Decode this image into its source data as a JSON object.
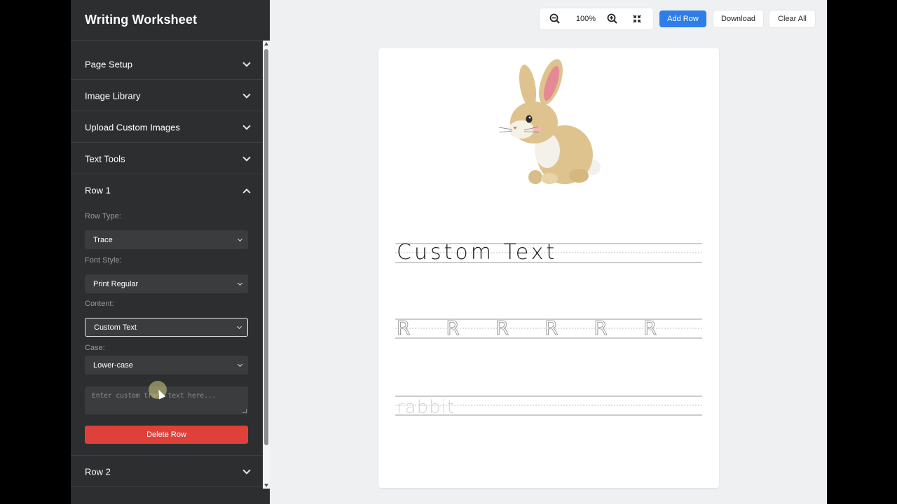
{
  "sidebar": {
    "title": "Writing Worksheet",
    "sections": [
      {
        "label": "Page Setup",
        "expanded": false
      },
      {
        "label": "Image Library",
        "expanded": false
      },
      {
        "label": "Upload Custom Images",
        "expanded": false
      },
      {
        "label": "Text Tools",
        "expanded": false
      },
      {
        "label": "Row 1",
        "expanded": true
      },
      {
        "label": "Row 2",
        "expanded": false
      }
    ],
    "row1": {
      "row_type_label": "Row Type:",
      "row_type_value": "Trace",
      "font_style_label": "Font Style:",
      "font_style_value": "Print Regular",
      "content_label": "Content:",
      "content_value": "Custom Text",
      "case_label": "Case:",
      "case_value": "Lower-case",
      "custom_text_placeholder": "Enter custom trace text here...",
      "delete_label": "Delete Row"
    }
  },
  "toolbar": {
    "zoom_out_icon": "zoom-out-icon",
    "zoom_level": "100%",
    "zoom_in_icon": "zoom-in-icon",
    "fit_icon": "fit-screen-icon",
    "add_row_label": "Add Row",
    "download_label": "Download",
    "clear_all_label": "Clear All"
  },
  "worksheet": {
    "image": "rabbit-illustration",
    "rows": [
      {
        "style": "solid",
        "text": "Custom Text"
      },
      {
        "style": "trace-letters",
        "text": "R R R R R R"
      },
      {
        "style": "faded",
        "text": "rabbit"
      }
    ]
  },
  "colors": {
    "sidebar_bg": "#2d2e2f",
    "accent": "#2f7ee8",
    "danger": "#e0403a",
    "canvas_bg": "#eef0f2"
  }
}
